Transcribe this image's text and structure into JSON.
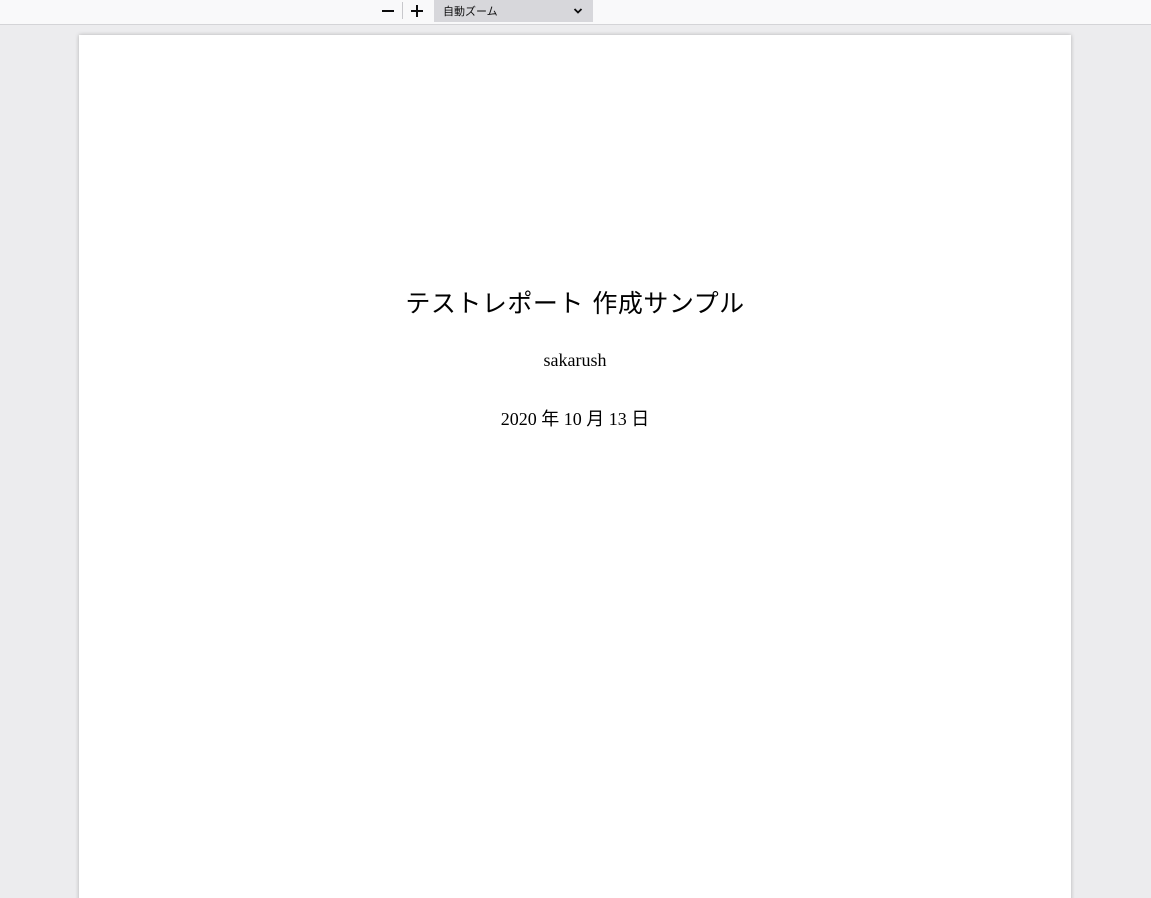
{
  "toolbar": {
    "zoom_out_icon": "minus-icon",
    "zoom_in_icon": "plus-icon",
    "zoom_select_value": "自動ズーム"
  },
  "document": {
    "title": "テストレポート 作成サンプル",
    "author": "sakarush",
    "date": "2020 年 10 月 13 日"
  }
}
